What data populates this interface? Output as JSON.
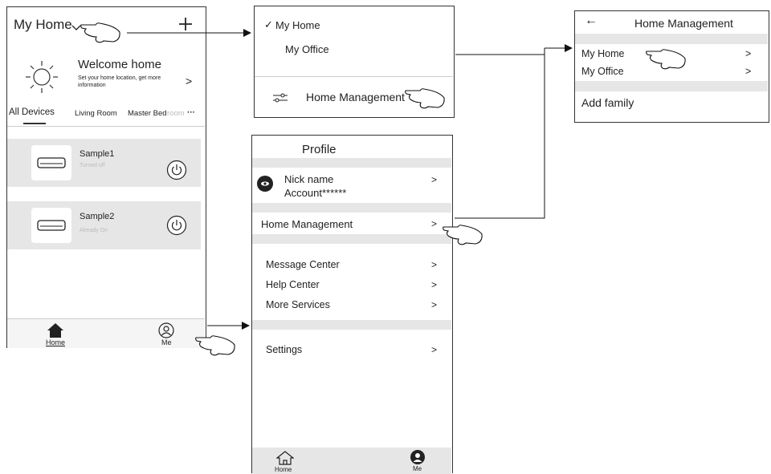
{
  "screen1": {
    "home_title": "My Home",
    "add_icon": "plus-icon",
    "welcome_title": "Welcome home",
    "welcome_sub": "Set your home location, get more information",
    "welcome_arrow": ">",
    "tabs": [
      "All Devices",
      "Living Room",
      "Master Bed",
      "room",
      "···"
    ],
    "devices": [
      {
        "name": "Sample1",
        "status": "Turned off"
      },
      {
        "name": "Sample2",
        "status": "Already On"
      }
    ],
    "nav_home": "Home",
    "nav_me": "Me"
  },
  "dropdown": {
    "check": "✓",
    "items": [
      "My Home",
      "My Office"
    ],
    "manage": "Home Management"
  },
  "homemgmt": {
    "back": "←",
    "title": "Home Management",
    "rows": [
      {
        "label": "My Home",
        "arrow": ">"
      },
      {
        "label": "My Office",
        "arrow": ">"
      }
    ],
    "add_family": "Add family"
  },
  "profile": {
    "title": "Profile",
    "nick": "Nick name",
    "account": "Account******",
    "rows": [
      {
        "label": "Home Management",
        "arrow": ">"
      },
      {
        "label": "Message Center",
        "arrow": ">"
      },
      {
        "label": "Help Center",
        "arrow": ">"
      },
      {
        "label": "More Services",
        "arrow": ">"
      },
      {
        "label": "Settings",
        "arrow": ">"
      }
    ],
    "nick_arrow": ">",
    "nav_home": "Home",
    "nav_me": "Me"
  }
}
